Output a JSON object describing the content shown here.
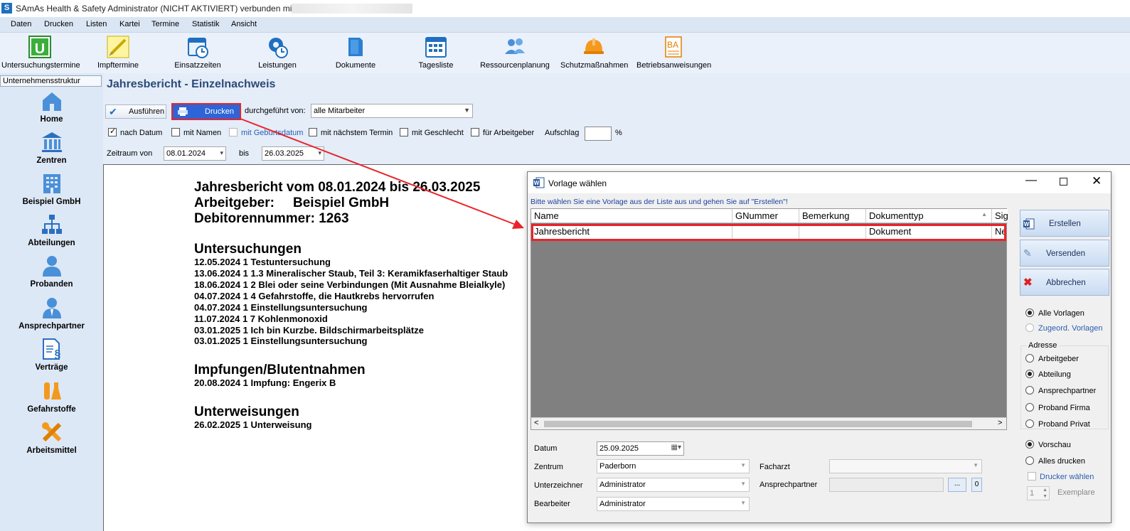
{
  "window": {
    "title": "SAmAs Health & Safety  Administrator (NICHT AKTIVIERT)  verbunden mit"
  },
  "menu": [
    "Daten",
    "Drucken",
    "Listen",
    "Kartei",
    "Termine",
    "Statistik",
    "Ansicht"
  ],
  "toolbar": [
    {
      "label": "Untersuchungstermine",
      "icon": "u-calendar-icon"
    },
    {
      "label": "Impftermine",
      "icon": "syringe-icon"
    },
    {
      "label": "Einsatzzeiten",
      "icon": "clock-calendar-icon"
    },
    {
      "label": "Leistungen",
      "icon": "gear-clock-icon"
    },
    {
      "label": "Dokumente",
      "icon": "folder-icon"
    },
    {
      "label": "Tagesliste",
      "icon": "calendar-grid-icon"
    },
    {
      "label": "Ressourcenplanung",
      "icon": "people-icon"
    },
    {
      "label": "Schutzmaßnahmen",
      "icon": "helmet-icon"
    },
    {
      "label": "Betriebsanweisungen",
      "icon": "ba-document-icon"
    }
  ],
  "sidebar": {
    "header": "Unternehmensstruktur",
    "items": [
      {
        "label": "Home",
        "icon": "home-icon"
      },
      {
        "label": "Zentren",
        "icon": "building-icon"
      },
      {
        "label": "Beispiel GmbH",
        "icon": "office-icon"
      },
      {
        "label": "Abteilungen",
        "icon": "org-chart-icon"
      },
      {
        "label": "Probanden",
        "icon": "person-icon"
      },
      {
        "label": "Ansprechpartner",
        "icon": "contact-icon"
      },
      {
        "label": "Verträge",
        "icon": "contract-icon"
      },
      {
        "label": "Gefahrstoffe",
        "icon": "flask-icon"
      },
      {
        "label": "Arbeitsmittel",
        "icon": "tools-icon"
      }
    ]
  },
  "page": {
    "title": "Jahresbericht - Einzelnachweis",
    "run_label": "Ausführen",
    "print_label": "Drucken",
    "performed_by_label": "durchgeführt von:",
    "performed_by_value": "alle Mitarbeiter",
    "options": [
      {
        "label": "nach Datum",
        "checked": true
      },
      {
        "label": "mit Namen",
        "checked": false
      },
      {
        "label": "mit Geburtsdatum",
        "checked": false
      },
      {
        "label": "mit nächstem Termin",
        "checked": false
      },
      {
        "label": "mit Geschlecht",
        "checked": false
      },
      {
        "label": "für Arbeitgeber",
        "checked": false
      }
    ],
    "surcharge_label": "Aufschlag",
    "surcharge_unit": "%",
    "period_from_label": "Zeitraum von",
    "period_from": "08.01.2024",
    "period_to_label": "bis",
    "period_to": "26.03.2025"
  },
  "report": {
    "heading": "Jahresbericht vom 08.01.2024 bis 26.03.2025",
    "employer_label": "Arbeitgeber:",
    "employer": "Beispiel GmbH",
    "debtor": "Debitorennummer: 1263",
    "sections": [
      {
        "title": "Untersuchungen",
        "lines": [
          "12.05.2024 1 Testuntersuchung",
          "13.06.2024 1 1.3 Mineralischer Staub, Teil 3: Keramikfaserhaltiger Staub",
          "18.06.2024 1 2 Blei oder seine Verbindungen (Mit Ausnahme Bleialkyle)",
          "04.07.2024 1 4 Gefahrstoffe, die Hautkrebs hervorrufen",
          "04.07.2024 1 Einstellungsuntersuchung",
          "11.07.2024 1 7 Kohlenmonoxid",
          "03.01.2025 1 Ich bin Kurzbe. Bildschirmarbeitsplätze",
          "03.01.2025 1 Einstellungsuntersuchung"
        ]
      },
      {
        "title": "Impfungen/Blutentnahmen",
        "lines": [
          "20.08.2024  1 Impfung: Engerix B"
        ]
      },
      {
        "title": "Unterweisungen",
        "lines": [
          "26.02.2025 1 Unterweisung"
        ]
      }
    ]
  },
  "dialog": {
    "title": "Vorlage wählen",
    "instruction": "Bitte wählen Sie eine Vorlage aus der Liste aus und gehen Sie auf \"Erstellen\"!",
    "columns": [
      "Name",
      "GNummer",
      "Bemerkung",
      "Dokumenttyp",
      "Sig"
    ],
    "rows": [
      {
        "name": "Jahresbericht",
        "gnummer": "",
        "bemerkung": "",
        "dokumenttyp": "Dokument",
        "sig": "Nei"
      }
    ],
    "buttons": {
      "create": "Erstellen",
      "send": "Versenden",
      "cancel": "Abbrechen"
    },
    "filter": [
      {
        "label": "Alle Vorlagen",
        "selected": true
      },
      {
        "label": "Zugeord. Vorlagen",
        "selected": false
      }
    ],
    "address_label": "Adresse",
    "address": [
      {
        "label": "Arbeitgeber",
        "selected": false
      },
      {
        "label": "Abteilung",
        "selected": true
      },
      {
        "label": "Ansprechpartner",
        "selected": false
      },
      {
        "label": "Proband Firma",
        "selected": false
      },
      {
        "label": "Proband Privat",
        "selected": false
      }
    ],
    "output": [
      {
        "label": "Vorschau",
        "selected": true
      },
      {
        "label": "Alles drucken",
        "selected": false
      }
    ],
    "choose_printer": "Drucker wählen",
    "copies_value": "1",
    "copies_label": "Exemplare",
    "date_label": "Datum",
    "date_value": "25.09.2025",
    "center_label": "Zentrum",
    "center_value": "Paderborn",
    "signer_label": "Unterzeichner",
    "signer_value": "Administrator",
    "editor_label": "Bearbeiter",
    "editor_value": "Administrator",
    "physician_label": "Facharzt",
    "physician_value": "",
    "contact_label": "Ansprechpartner",
    "contact_value": "",
    "dots_label": "...",
    "count_label": "0"
  },
  "colors": {
    "highlight_red": "#e8242a",
    "print_button_blue": "#2e64d6",
    "title_blue": "#2c4a78"
  }
}
